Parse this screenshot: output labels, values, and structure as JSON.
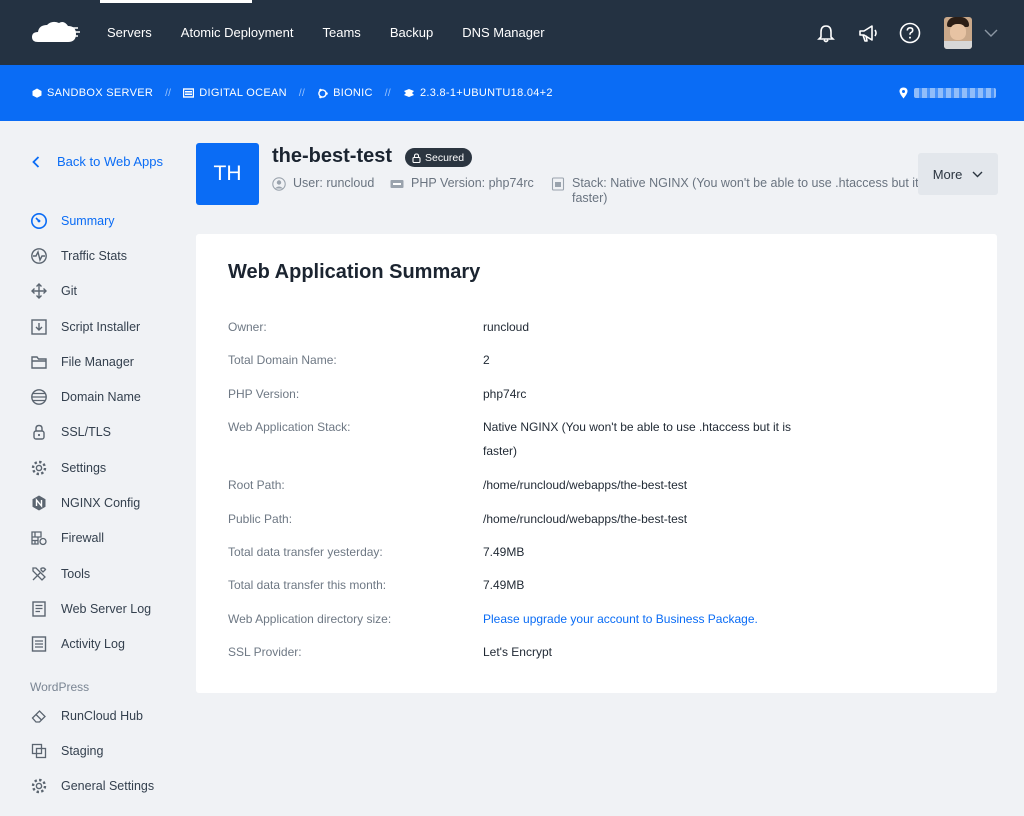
{
  "nav": {
    "links": [
      "Servers",
      "Atomic Deployment",
      "Teams",
      "Backup",
      "DNS Manager"
    ]
  },
  "server_bar": {
    "server": "SANDBOX SERVER",
    "provider": "DIGITAL OCEAN",
    "os": "BIONIC",
    "version": "2.3.8-1+UBUNTU18.04+2"
  },
  "sidebar": {
    "back": "Back to Web Apps",
    "items": [
      {
        "label": "Summary",
        "icon": "gauge-icon"
      },
      {
        "label": "Traffic Stats",
        "icon": "pulse-icon"
      },
      {
        "label": "Git",
        "icon": "git-icon"
      },
      {
        "label": "Script Installer",
        "icon": "download-box-icon"
      },
      {
        "label": "File Manager",
        "icon": "folder-icon"
      },
      {
        "label": "Domain Name",
        "icon": "globe-icon"
      },
      {
        "label": "SSL/TLS",
        "icon": "lock-icon"
      },
      {
        "label": "Settings",
        "icon": "gear-icon"
      },
      {
        "label": "NGINX Config",
        "icon": "nginx-icon"
      },
      {
        "label": "Firewall",
        "icon": "firewall-icon"
      },
      {
        "label": "Tools",
        "icon": "tools-icon"
      },
      {
        "label": "Web Server Log",
        "icon": "document-icon"
      },
      {
        "label": "Activity Log",
        "icon": "log-icon"
      }
    ],
    "section": "WordPress",
    "wp_items": [
      {
        "label": "RunCloud Hub",
        "icon": "eraser-icon"
      },
      {
        "label": "Staging",
        "icon": "copy-icon"
      },
      {
        "label": "General Settings",
        "icon": "gear-icon"
      }
    ]
  },
  "app": {
    "initials": "TH",
    "name": "the-best-test",
    "badge": "Secured",
    "user": "User: runcloud",
    "php": "PHP Version: php74rc",
    "stack": "Stack: Native NGINX (You won't be able to use .htaccess but it is faster)",
    "more": "More"
  },
  "summary": {
    "title": "Web Application Summary",
    "rows": [
      {
        "k": "Owner:",
        "v": "runcloud"
      },
      {
        "k": "Total Domain Name:",
        "v": "2"
      },
      {
        "k": "PHP Version:",
        "v": "php74rc"
      },
      {
        "k": "Web Application Stack:",
        "v": "Native NGINX (You won't be able to use .htaccess but it is faster)"
      },
      {
        "k": "Root Path:",
        "v": "/home/runcloud/webapps/the-best-test"
      },
      {
        "k": "Public Path:",
        "v": "/home/runcloud/webapps/the-best-test"
      },
      {
        "k": "Total data transfer yesterday:",
        "v": "7.49MB"
      },
      {
        "k": "Total data transfer this month:",
        "v": "7.49MB"
      },
      {
        "k": "Web Application directory size:",
        "v": "Please upgrade your account to Business Package."
      },
      {
        "k": "SSL Provider:",
        "v": "Let's Encrypt"
      }
    ]
  },
  "colors": {
    "accent": "#0a6cf5",
    "topbar": "#243242",
    "badge": "#2b3540"
  }
}
